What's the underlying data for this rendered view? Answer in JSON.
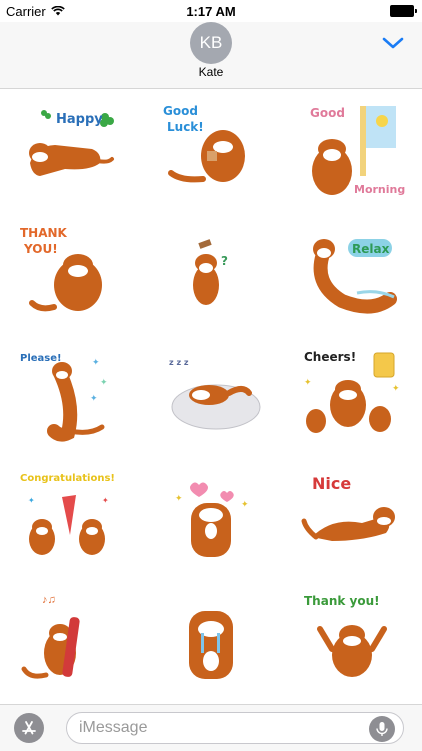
{
  "status_bar": {
    "carrier": "Carrier",
    "time": "1:17 AM"
  },
  "header": {
    "avatar_initials": "KB",
    "contact_name": "Kate"
  },
  "stickers": [
    {
      "id": "happy",
      "texts": [
        "Happy"
      ]
    },
    {
      "id": "good-luck",
      "texts": [
        "Good",
        "Luck!"
      ]
    },
    {
      "id": "good-morning",
      "texts": [
        "Good",
        "Morning"
      ]
    },
    {
      "id": "thank-you-lying",
      "texts": [
        "THANK",
        "YOU!"
      ]
    },
    {
      "id": "confused",
      "texts": [
        "?"
      ]
    },
    {
      "id": "relax",
      "texts": [
        "Relax"
      ]
    },
    {
      "id": "please",
      "texts": [
        "Please!"
      ]
    },
    {
      "id": "sleeping",
      "texts": [
        "z z z"
      ]
    },
    {
      "id": "cheers",
      "texts": [
        "Cheers!"
      ]
    },
    {
      "id": "congratulations",
      "texts": [
        "Congratulations!"
      ]
    },
    {
      "id": "love",
      "texts": []
    },
    {
      "id": "nice",
      "texts": [
        "Nice"
      ]
    },
    {
      "id": "music",
      "texts": []
    },
    {
      "id": "crying",
      "texts": []
    },
    {
      "id": "thank-you-arms",
      "texts": [
        "Thank you!"
      ]
    }
  ],
  "input_bar": {
    "placeholder": "iMessage"
  },
  "colors": {
    "otter": "#c8621c",
    "accent_blue": "#1a7cf5",
    "header_bg": "#f7f7f7"
  }
}
